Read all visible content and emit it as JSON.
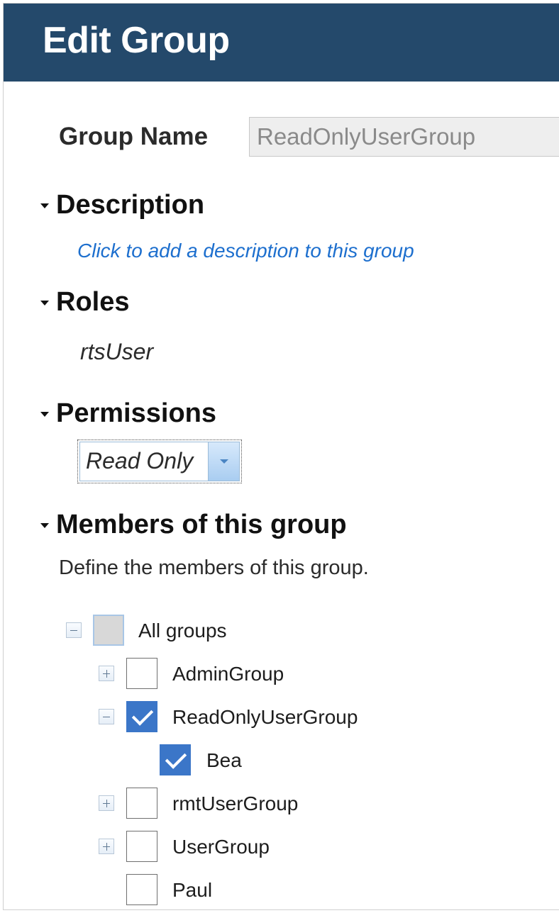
{
  "dialog": {
    "title": "Edit Group"
  },
  "group_name": {
    "label": "Group Name",
    "value": "ReadOnlyUserGroup"
  },
  "description": {
    "heading": "Description",
    "link": "Click to add a description to this group"
  },
  "roles": {
    "heading": "Roles",
    "value": "rtsUser"
  },
  "permissions": {
    "heading": "Permissions",
    "selected": "Read Only"
  },
  "members": {
    "heading": "Members of this group",
    "help": "Define the members of this group.",
    "tree": [
      {
        "label": "All groups",
        "level": 0,
        "expander": "minus",
        "check": "partial"
      },
      {
        "label": "AdminGroup",
        "level": 1,
        "expander": "plus",
        "check": "unchecked"
      },
      {
        "label": "ReadOnlyUserGroup",
        "level": 1,
        "expander": "minus",
        "check": "checked"
      },
      {
        "label": "Bea",
        "level": 2,
        "expander": "none",
        "check": "checked"
      },
      {
        "label": "rmtUserGroup",
        "level": 1,
        "expander": "plus",
        "check": "unchecked"
      },
      {
        "label": "UserGroup",
        "level": 1,
        "expander": "plus",
        "check": "unchecked"
      },
      {
        "label": "Paul",
        "level": 1,
        "expander": "none",
        "check": "unchecked"
      }
    ]
  },
  "colors": {
    "title_bar": "#24496b",
    "link": "#1d6fce",
    "checkbox_checked": "#3b76c8"
  }
}
